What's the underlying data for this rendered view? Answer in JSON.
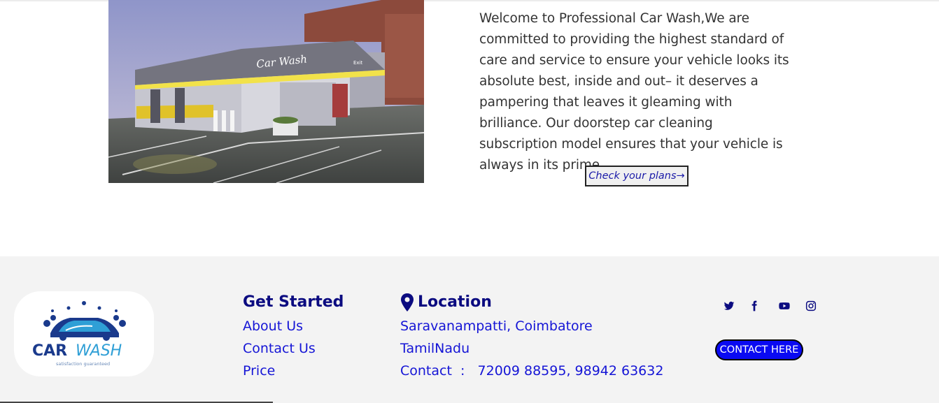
{
  "hero": {
    "image_sign_text": "Car Wash",
    "image_exit_text": "Exit",
    "intro": "Welcome to Professional Car Wash,We are committed to providing the highest standard of care and service to ensure your vehicle looks its absolute best, inside and out– it deserves a pampering that leaves it gleaming with brilliance. Our doorstep car cleaning subscription model ensures that your vehicle is always in its prime",
    "plans_button": "Check your plans→"
  },
  "footer": {
    "logo": {
      "word1": "CAR",
      "word2": "WASH",
      "tagline": "satisfaction guaranteed"
    },
    "get_started": {
      "title": "Get Started",
      "links": [
        "About Us",
        "Contact Us",
        "Price"
      ]
    },
    "location": {
      "title": "Location",
      "address_line1": "Saravanampatti, Coimbatore",
      "address_line2": "TamilNadu",
      "contact": "Contact  :   72009 88595, 98942 63632"
    },
    "social_icons": [
      "twitter-icon",
      "facebook-icon",
      "youtube-icon",
      "instagram-icon"
    ],
    "contact_button": "CONTACT HERE"
  },
  "colors": {
    "heading": "#0b0b80",
    "link": "#1515d6",
    "footer_bg": "#f3f3f3",
    "contact_button_bg": "#0a0af2"
  }
}
